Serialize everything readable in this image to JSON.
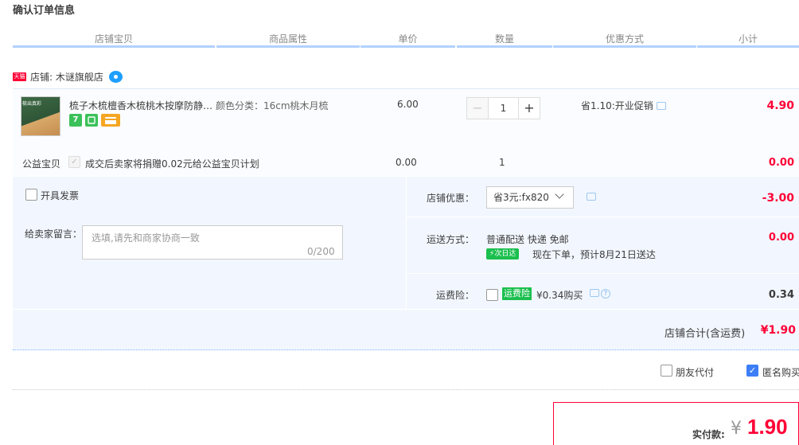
{
  "page_title": "确认订单信息",
  "columns": [
    "店铺宝贝",
    "商品属性",
    "单价",
    "数量",
    "优惠方式",
    "小计"
  ],
  "shop": {
    "badge": "天猫",
    "label": "店铺: 木谜旗舰店"
  },
  "item": {
    "thumb_label": "梳出真彩",
    "title": "梳子木梳檀香木梳桃木按摩防静电",
    "title_ellipsis": "梳子木梳檀香木梳桃木按摩防静…",
    "attr": "颜色分类：16cm桃木月梳",
    "unit_price": "6.00",
    "quantity": "1",
    "qty_minus": "−",
    "qty_plus": "+",
    "promo": "省1.10:开业促销",
    "subtotal": "4.90",
    "service_7": "7"
  },
  "charity": {
    "label": "公益宝贝",
    "text": "成交后卖家将捐赠0.02元给公益宝贝计划",
    "price": "0.00",
    "qty": "1",
    "total": "0.00"
  },
  "invoice": {
    "label": "开具发票"
  },
  "message": {
    "label": "给卖家留言：",
    "placeholder": "选填,请先和商家协商一致",
    "count": "0/200"
  },
  "shop_discount": {
    "label": "店铺优惠：",
    "selected": "省3元:fx820",
    "amount": "-3.00"
  },
  "shipping": {
    "label": "运送方式：",
    "method": "普通配送 快递 免邮",
    "badge": "次日达",
    "eta": "现在下单，预计8月21日送达",
    "fee": "0.00"
  },
  "insurance": {
    "label": "运费险：",
    "badge": "运费险",
    "price": "¥0.34购买",
    "amount": "0.34"
  },
  "shop_total": {
    "label": "店铺合计(含运费)",
    "value": "¥1.90"
  },
  "options": {
    "friend_pay": "朋友代付",
    "anonymous": "匿名购买"
  },
  "payment": {
    "label": "实付款:",
    "currency": "¥",
    "amount": "1.90"
  },
  "colors": {
    "accent_red": "#ff0036",
    "header_blue": "#b2d1ff",
    "panel_bg": "#f2f7ff",
    "green_badge": "#1bbf4e"
  }
}
